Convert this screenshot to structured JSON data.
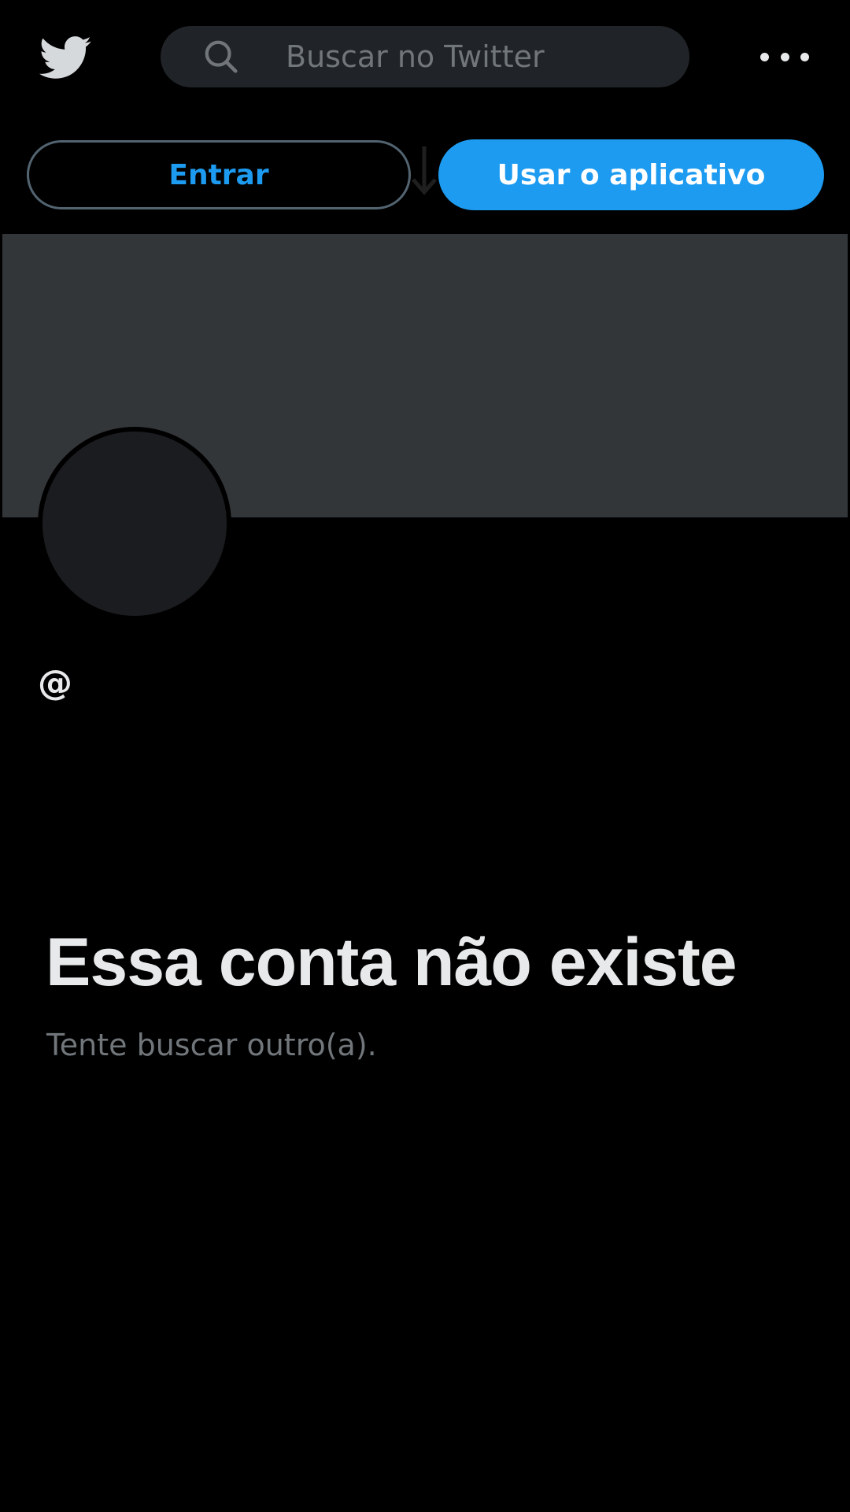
{
  "app": {
    "name": "Twitter",
    "logo_icon": "twitter-bird-icon",
    "logo_color": "#d6d9db"
  },
  "search": {
    "placeholder": "Buscar no Twitter",
    "icon": "search-icon"
  },
  "header": {
    "more_icon": "more-horizontal-icon"
  },
  "actions": {
    "login_label": "Entrar",
    "app_label": "Usar o aplicativo",
    "download_icon": "download-arrow-icon"
  },
  "profile": {
    "handle": "@"
  },
  "empty_state": {
    "title": "Essa conta não existe",
    "subtitle": "Tente buscar outro(a)."
  },
  "colors": {
    "background": "#000000",
    "accent": "#1d9bf0",
    "banner": "#333639",
    "avatar": "#1b1c1f",
    "primary_text": "#e7e9ea",
    "secondary_text": "#71767b",
    "search_bg": "#202327",
    "outline": "#536471"
  }
}
